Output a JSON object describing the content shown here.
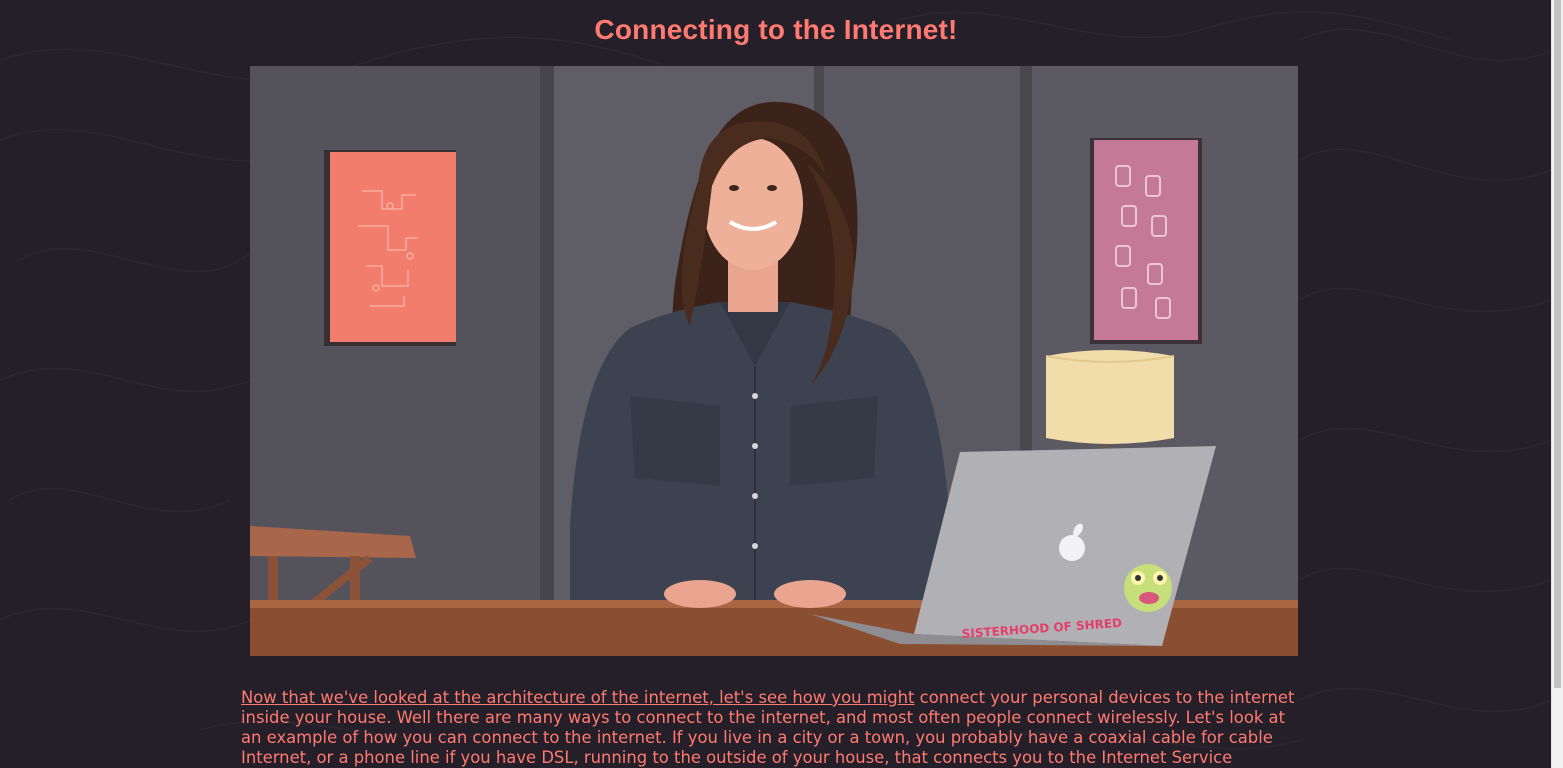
{
  "page": {
    "title": "Connecting to the Internet!"
  },
  "video": {
    "sticker_text": "SISTERHOOD OF SHRED",
    "laptop_logo": "apple-logo-icon"
  },
  "transcript": {
    "highlighted": "Now that we've looked at the architecture of the internet, let's see how you might",
    "rest": " connect your personal devices to the internet inside your house. Well there are many ways to connect to the internet, and most often people connect wirelessly. Let's look at an example of how you can connect to the internet. If you live in a city or a town, you probably have a coaxial cable for cable Internet, or a phone line if you have DSL, running to the outside of your house, that connects you to the Internet Service"
  },
  "colors": {
    "background": "#241f28",
    "accent": "#ff7a70"
  }
}
